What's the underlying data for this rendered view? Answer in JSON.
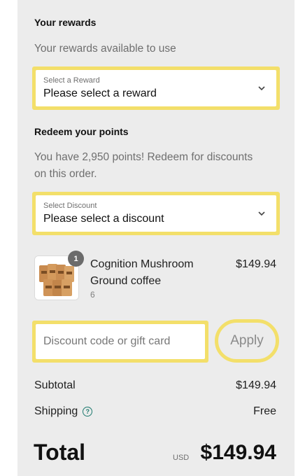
{
  "rewards": {
    "heading": "Your rewards",
    "subtext": "Your rewards available to use",
    "select_label": "Select a Reward",
    "select_value": "Please select a reward"
  },
  "points": {
    "heading": "Redeem your points",
    "subtext_line1": "You have 2,950 points! Redeem for discounts",
    "subtext_line2": "on this order.",
    "select_label": "Select Discount",
    "select_value": "Please select a discount"
  },
  "product": {
    "name_line1": "Cognition Mushroom",
    "name_line2": "Ground coffee",
    "variant": "6",
    "price": "$149.94",
    "quantity_badge": "1"
  },
  "discount": {
    "placeholder": "Discount code or gift card",
    "apply_label": "Apply"
  },
  "summary": {
    "subtotal_label": "Subtotal",
    "subtotal_value": "$149.94",
    "shipping_label": "Shipping",
    "shipping_value": "Free",
    "total_label": "Total",
    "currency": "USD",
    "total_value": "$149.94"
  },
  "colors": {
    "highlight": "#f3df6a",
    "panel_bg": "#ececec",
    "help_icon": "#1e7a6f"
  },
  "icons": [
    "chevron-down-icon",
    "help-circle-icon",
    "coffee-bags-image"
  ]
}
